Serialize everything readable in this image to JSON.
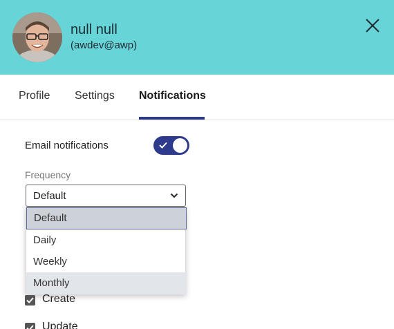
{
  "user": {
    "name": "null null",
    "handle": "(awdev@awp)"
  },
  "tabs": [
    {
      "label": "Profile"
    },
    {
      "label": "Settings"
    },
    {
      "label": "Notifications"
    }
  ],
  "notifications": {
    "email_label": "Email notifications",
    "email_enabled": true,
    "frequency_label": "Frequency",
    "frequency_value": "Default",
    "frequency_options": [
      "Default",
      "Daily",
      "Weekly",
      "Monthly"
    ],
    "checkboxes": [
      {
        "label": "Create",
        "checked": true
      },
      {
        "label": "Update",
        "checked": true
      }
    ]
  },
  "colors": {
    "header_bg": "#67d4d8",
    "accent": "#2e3b8c"
  },
  "icons": {
    "close": "close-icon",
    "chevron": "chevron-down-icon",
    "check": "check-icon"
  }
}
